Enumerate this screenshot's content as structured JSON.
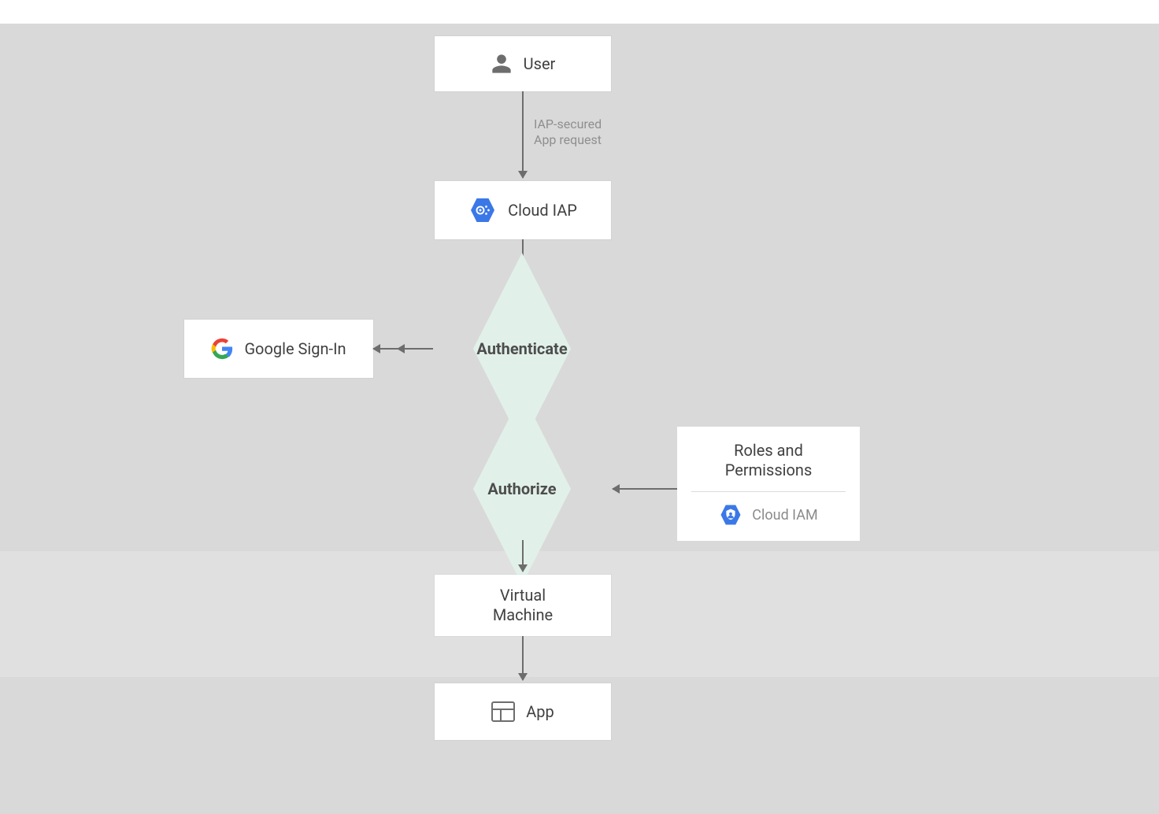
{
  "nodes": {
    "user": {
      "label": "User"
    },
    "iap": {
      "label": "Cloud IAP"
    },
    "signin": {
      "label": "Google Sign-In"
    },
    "auth": {
      "label": "Authenticate"
    },
    "authorize": {
      "label": "Authorize"
    },
    "vm": {
      "label": "Virtual\nMachine"
    },
    "app": {
      "label": "App"
    }
  },
  "card": {
    "title": "Roles and\nPermissions",
    "iam_label": "Cloud IAM"
  },
  "edges": {
    "request_label": "IAP-secured\nApp request"
  },
  "colors": {
    "blue": "#3b78e7",
    "mint": "#e1f1e9"
  }
}
